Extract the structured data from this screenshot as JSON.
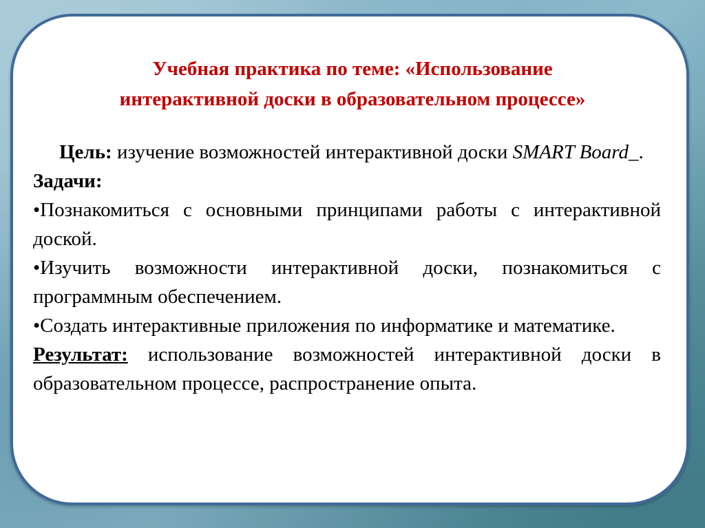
{
  "slide": {
    "title_line1": "Учебная практика по теме: «Использование",
    "title_line2": "интерактивной доски в образовательном процессе»",
    "goal": {
      "label": "Цель:",
      "text": " изучение возможностей интерактивной доски ",
      "italic_text": "SMART Board_",
      "end": "."
    },
    "tasks": {
      "label": "Задачи:",
      "bullet": "•",
      "items": [
        "Познакомиться с основными принципами работы с интерактивной доской.",
        "Изучить возможности интерактивной доски, познакомиться с программным обеспечением.",
        "Создать интерактивные приложения по информатике и математике."
      ]
    },
    "result": {
      "label": "Результат:",
      "text": " использование возможностей интерактивной доски в образовательном процессе, распространение опыта."
    }
  },
  "colors": {
    "title": "#c00000",
    "border": "#3f6a99",
    "text": "#000000"
  }
}
